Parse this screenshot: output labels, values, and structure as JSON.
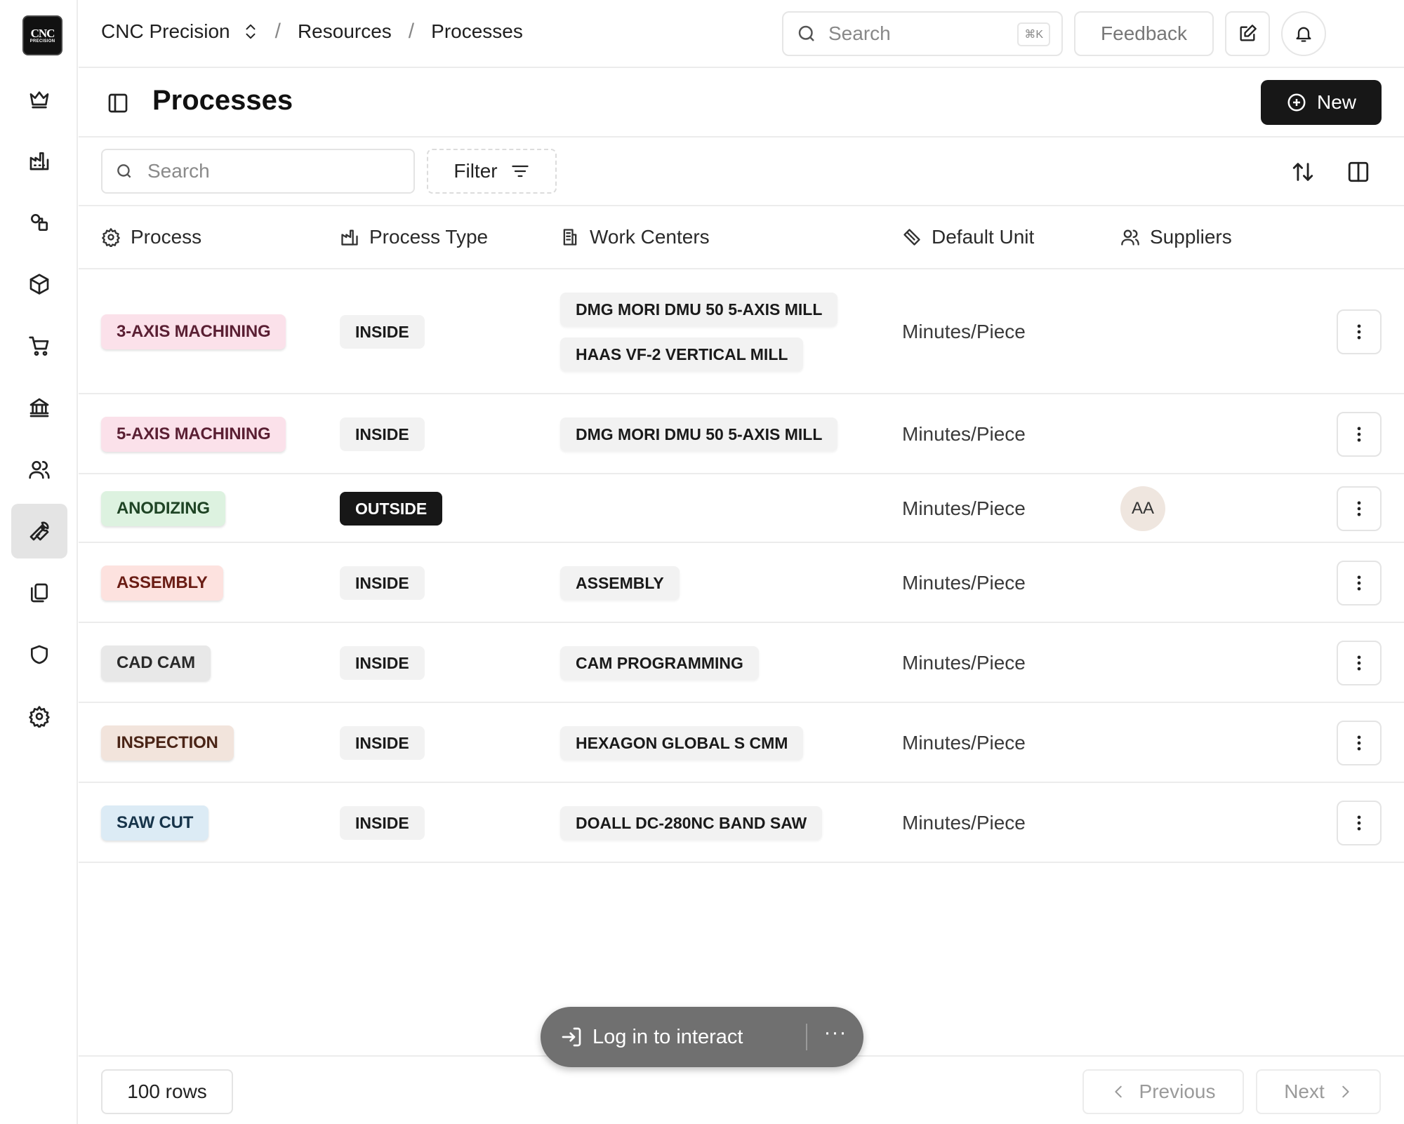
{
  "logo": {
    "line1": "CNC",
    "line2": "PRECISION"
  },
  "sidebar": {
    "items": [
      {
        "icon": "crown-icon",
        "active": false
      },
      {
        "icon": "factory-icon",
        "active": false
      },
      {
        "icon": "shapes-icon",
        "active": false
      },
      {
        "icon": "cube-icon",
        "active": false
      },
      {
        "icon": "cart-icon",
        "active": false
      },
      {
        "icon": "bank-icon",
        "active": false
      },
      {
        "icon": "users-icon",
        "active": false
      },
      {
        "icon": "wrench-icon",
        "active": true
      },
      {
        "icon": "documents-icon",
        "active": false
      },
      {
        "icon": "shield-icon",
        "active": false
      },
      {
        "icon": "gear-icon",
        "active": false
      }
    ]
  },
  "header": {
    "company": "CNC Precision",
    "breadcrumb": [
      "Resources",
      "Processes"
    ],
    "search_placeholder": "Search",
    "search_shortcut": "⌘K",
    "feedback_label": "Feedback"
  },
  "page": {
    "title": "Processes",
    "new_label": "New"
  },
  "toolbar": {
    "search_placeholder": "Search",
    "filter_label": "Filter"
  },
  "table": {
    "columns": [
      "Process",
      "Process Type",
      "Work Centers",
      "Default Unit",
      "Suppliers"
    ],
    "rows": [
      {
        "process": "3-AXIS MACHINING",
        "process_color": "#fbe1ea",
        "process_text": "#5a1f33",
        "type": "INSIDE",
        "type_dark": false,
        "work_centers": [
          "DMG MORI DMU 50 5-AXIS MILL",
          "HAAS VF-2 VERTICAL MILL"
        ],
        "unit": "Minutes/Piece",
        "suppliers": []
      },
      {
        "process": "5-AXIS MACHINING",
        "process_color": "#fbe1ea",
        "process_text": "#5a1f33",
        "type": "INSIDE",
        "type_dark": false,
        "work_centers": [
          "DMG MORI DMU 50 5-AXIS MILL"
        ],
        "unit": "Minutes/Piece",
        "suppliers": []
      },
      {
        "process": "ANODIZING",
        "process_color": "#ddf2e0",
        "process_text": "#1f4425",
        "type": "OUTSIDE",
        "type_dark": true,
        "work_centers": [],
        "unit": "Minutes/Piece",
        "suppliers": [
          "AA"
        ]
      },
      {
        "process": "ASSEMBLY",
        "process_color": "#fde2df",
        "process_text": "#6a1d15",
        "type": "INSIDE",
        "type_dark": false,
        "work_centers": [
          "ASSEMBLY"
        ],
        "unit": "Minutes/Piece",
        "suppliers": []
      },
      {
        "process": "CAD CAM",
        "process_color": "#e8e8e8",
        "process_text": "#2a2a2a",
        "type": "INSIDE",
        "type_dark": false,
        "work_centers": [
          "CAM PROGRAMMING"
        ],
        "unit": "Minutes/Piece",
        "suppliers": []
      },
      {
        "process": "INSPECTION",
        "process_color": "#f2e4dc",
        "process_text": "#4a2416",
        "type": "INSIDE",
        "type_dark": false,
        "work_centers": [
          "HEXAGON GLOBAL S CMM"
        ],
        "unit": "Minutes/Piece",
        "suppliers": []
      },
      {
        "process": "SAW CUT",
        "process_color": "#dcebf5",
        "process_text": "#17344a",
        "type": "INSIDE",
        "type_dark": false,
        "work_centers": [
          "DOALL DC-280NC BAND SAW"
        ],
        "unit": "Minutes/Piece",
        "suppliers": []
      }
    ]
  },
  "footer": {
    "rows_label": "100 rows",
    "previous_label": "Previous",
    "next_label": "Next"
  },
  "overlay": {
    "login_label": "Log in to interact",
    "more_label": "···"
  }
}
